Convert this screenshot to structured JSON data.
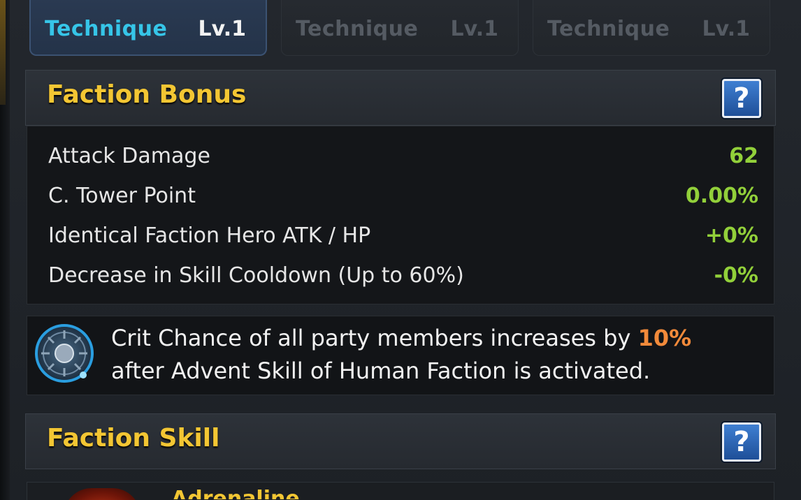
{
  "tabs": [
    {
      "name": "Technique",
      "level": "Lv.1",
      "active": true
    },
    {
      "name": "Technique",
      "level": "Lv.1",
      "active": false
    },
    {
      "name": "Technique",
      "level": "Lv.1",
      "active": false
    }
  ],
  "faction_bonus": {
    "title": "Faction Bonus",
    "help_label": "?",
    "stats": [
      {
        "label": "Attack Damage",
        "value": "62"
      },
      {
        "label": "C. Tower Point",
        "value": "0.00%"
      },
      {
        "label": "Identical Faction Hero ATK / HP",
        "value": "+0%"
      },
      {
        "label": "Decrease in Skill Cooldown (Up to 60%)",
        "value": "-0%"
      }
    ],
    "description": {
      "part1": "Crit Chance of all party members increases by ",
      "highlight": "10%",
      "part2": "after Advent Skill of Human Faction is activated."
    }
  },
  "faction_skill": {
    "title": "Faction Skill",
    "help_label": "?",
    "skill_name": "Adrenaline"
  },
  "colors": {
    "title_gold": "#f3c633",
    "active_tab_cyan": "#36c5e8",
    "stat_green": "#92d03a",
    "highlight_orange": "#f28a3a"
  },
  "icons": {
    "help": "question-mark-icon",
    "faction_emblem": "human-faction-emblem-icon"
  }
}
